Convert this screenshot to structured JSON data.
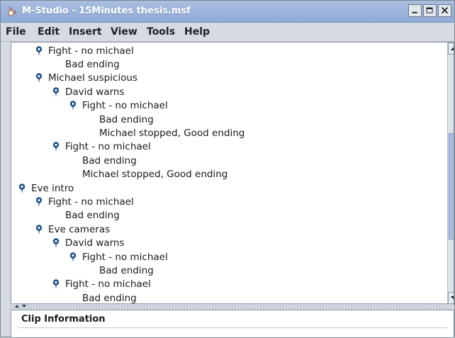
{
  "window": {
    "title": "M-Studio - 15Minutes thesis.msf",
    "controls": [
      "minimize",
      "maximize",
      "close"
    ]
  },
  "menu": [
    "File",
    "Edit",
    "Insert",
    "View",
    "Tools",
    "Help"
  ],
  "tree": {
    "rows": [
      {
        "text": "Fight - no michael",
        "level": 1,
        "icon": true
      },
      {
        "text": "Bad ending",
        "level": 2,
        "icon": false
      },
      {
        "text": "Michael suspicious",
        "level": 1,
        "icon": true
      },
      {
        "text": "David warns",
        "level": 2,
        "icon": true
      },
      {
        "text": "Fight - no michael",
        "level": 3,
        "icon": true
      },
      {
        "text": "Bad ending",
        "level": 4,
        "icon": false
      },
      {
        "text": "Michael stopped, Good ending",
        "level": 4,
        "icon": false
      },
      {
        "text": "Fight - no michael",
        "level": 2,
        "icon": true
      },
      {
        "text": "Bad ending",
        "level": 3,
        "icon": false
      },
      {
        "text": "Michael stopped, Good ending",
        "level": 3,
        "icon": false
      },
      {
        "text": "Eve intro",
        "level": 0,
        "icon": true
      },
      {
        "text": "Fight - no michael",
        "level": 1,
        "icon": true
      },
      {
        "text": "Bad ending",
        "level": 2,
        "icon": false
      },
      {
        "text": "Eve cameras",
        "level": 1,
        "icon": true
      },
      {
        "text": "David warns",
        "level": 2,
        "icon": true
      },
      {
        "text": "Fight - no michael",
        "level": 3,
        "icon": true
      },
      {
        "text": "Bad ending",
        "level": 4,
        "icon": false
      },
      {
        "text": "Fight - no michael",
        "level": 2,
        "icon": true
      },
      {
        "text": "Bad ending",
        "level": 3,
        "icon": false
      }
    ],
    "scroll_position": 0.6
  },
  "clip_info": {
    "title": "Clip Information"
  },
  "colors": {
    "pin": "#1f4f86",
    "titlebar": "#a9bedf"
  },
  "icons": {
    "app": "app-cup-icon",
    "tree_node": "map-pin-icon"
  }
}
